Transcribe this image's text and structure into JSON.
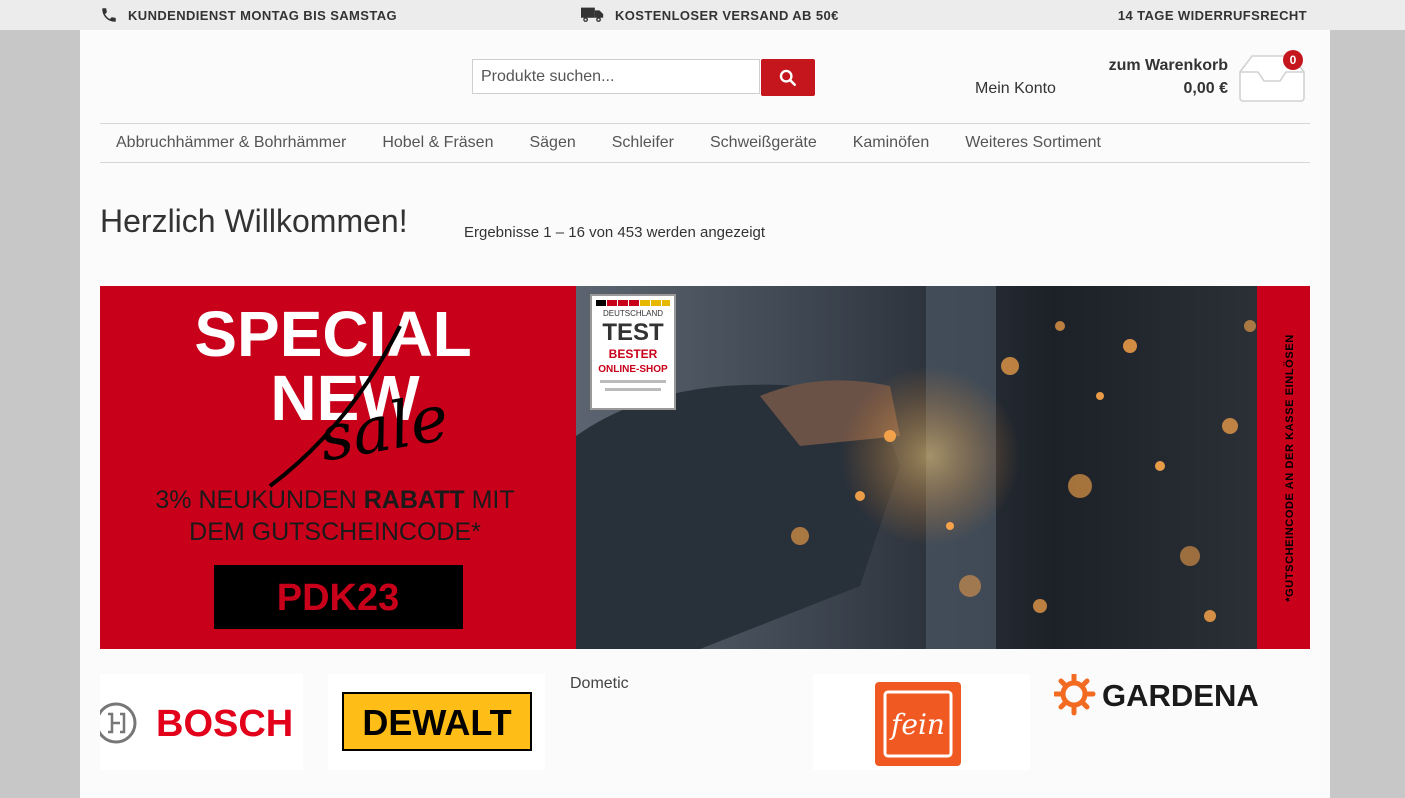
{
  "topbar": {
    "service_text": "KUNDENDIENST MONTAG BIS SAMSTAG",
    "shipping_text": "KOSTENLOSER VERSAND AB 50€",
    "return_text": "14 TAGE WIDERRUFSRECHT"
  },
  "header": {
    "search_placeholder": "Produkte suchen...",
    "account_label": "Mein Konto",
    "cart_label": "zum Warenkorb",
    "cart_total": "0,00 €",
    "cart_count": "0"
  },
  "nav": {
    "items": [
      {
        "label": "Abbruchhämmer & Bohrhämmer"
      },
      {
        "label": "Hobel & Fräsen"
      },
      {
        "label": "Sägen"
      },
      {
        "label": "Schleifer"
      },
      {
        "label": "Schweißgeräte"
      },
      {
        "label": "Kaminöfen"
      },
      {
        "label": "Weiteres Sortiment"
      }
    ]
  },
  "main": {
    "title": "Herzlich Willkommen!",
    "result_count": "Ergebnisse 1 – 16 von 453 werden angezeigt"
  },
  "banner": {
    "line1": "SPECIAL",
    "line2": "NEW",
    "script_word": "sale",
    "offer_line1_pre": "3%  NEUKUNDEN ",
    "offer_line1_bold": "RABATT",
    "offer_line1_post": " MIT",
    "offer_line2": "DEM GUTSCHEINCODE*",
    "code": "PDK23",
    "side_text": "*GUTSCHEINCODE AN DER KASSE EINLÖSEN",
    "badge_top": "DEUTSCHLAND",
    "badge_main": "TEST",
    "badge_line1": "BESTER",
    "badge_line2": "ONLINE-SHOP",
    "accent_color": "#c8001a"
  },
  "brands": {
    "bosch": "BOSCH",
    "dewalt": "DEWALT",
    "dometic": "Dometic",
    "fein": "fein",
    "gardena": "GARDENA"
  },
  "colors": {
    "accent": "#c4161c",
    "topbar_bg": "#ececec",
    "page_bg": "#fbfbfb"
  }
}
